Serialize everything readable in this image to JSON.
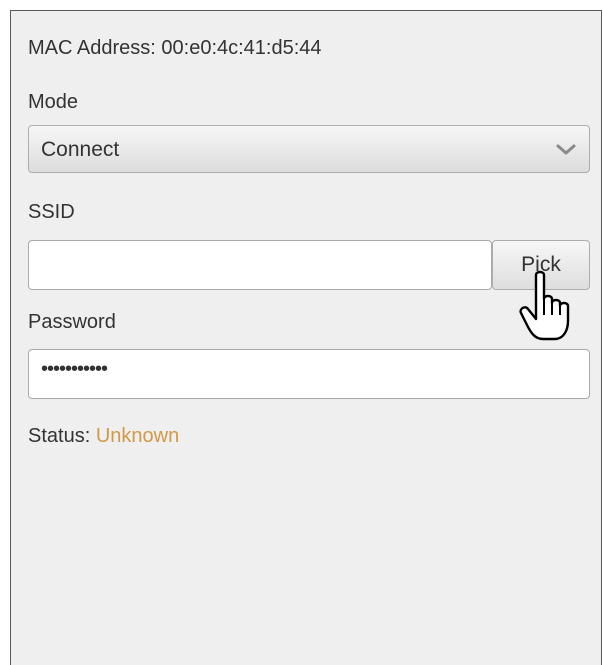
{
  "device": {
    "mac_label": "MAC Address:",
    "mac_value": "00:e0:4c:41:d5:44"
  },
  "mode": {
    "label": "Mode",
    "selected": "Connect",
    "chevron_icon": "chevron-down-icon"
  },
  "ssid": {
    "label": "SSID",
    "value": "",
    "pick_button_label": "Pick"
  },
  "password": {
    "label": "Password",
    "masked_value": "•••••••••••"
  },
  "status": {
    "label": "Status:",
    "value": "Unknown",
    "value_color": "#d09a4a"
  },
  "pointer": {
    "icon": "hand-pointer-icon"
  }
}
